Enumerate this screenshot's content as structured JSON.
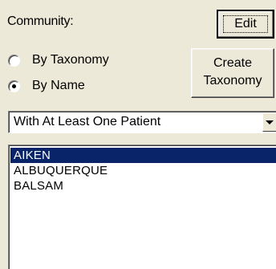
{
  "community": {
    "label": "Community:",
    "edit_label": "Edit",
    "create_label_line1": "Create",
    "create_label_line2": "Taxonomy",
    "radios": [
      {
        "label": "By Taxonomy",
        "checked": false
      },
      {
        "label": "By Name",
        "checked": true
      }
    ],
    "filter": {
      "selected": "With At Least One Patient"
    },
    "list": {
      "items": [
        "AIKEN",
        "ALBUQUERQUE",
        "BALSAM"
      ],
      "selected_index": 0
    }
  },
  "colors": {
    "background": "#ece9d8",
    "selection": "#0a246a"
  }
}
